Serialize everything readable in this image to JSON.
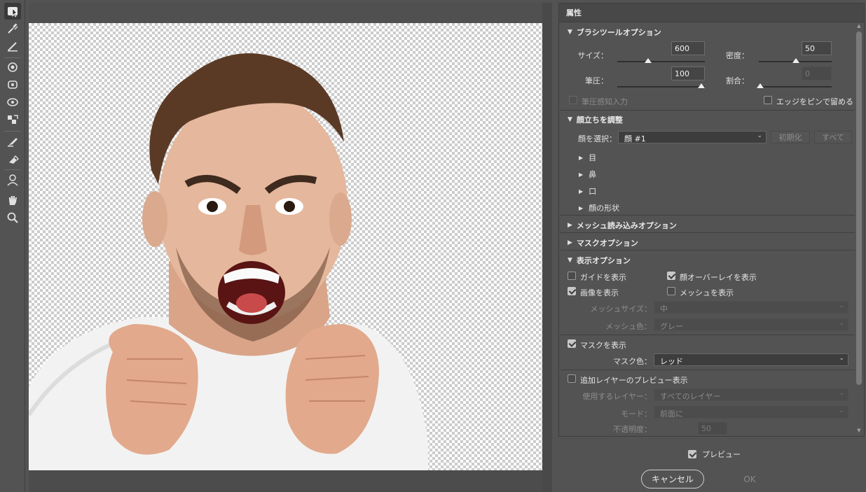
{
  "panel": {
    "title": "属性",
    "brush": {
      "title": "ブラシツールオプション",
      "size_label": "サイズ：",
      "size_value": "600",
      "density_label": "密度：",
      "density_value": "50",
      "pressure_label": "筆圧：",
      "pressure_value": "100",
      "rate_label": "割合：",
      "rate_value": "0",
      "stylus_label": "筆圧感知入力",
      "pin_edges_label": "エッジをピンで留める"
    },
    "face": {
      "title": "顔立ちを調整",
      "select_label": "顔を選択：",
      "select_value": "顔 #1",
      "reset_label": "初期化",
      "all_label": "すべて",
      "items": [
        {
          "label": "目"
        },
        {
          "label": "鼻"
        },
        {
          "label": "口"
        },
        {
          "label": "顔の形状"
        }
      ]
    },
    "mesh_load": {
      "title": "メッシュ読み込みオプション"
    },
    "mask_options": {
      "title": "マスクオプション"
    },
    "view": {
      "title": "表示オプション",
      "show_guides": "ガイドを表示",
      "show_face_overlay": "顔オーバーレイを表示",
      "show_image": "画像を表示",
      "show_mesh": "メッシュを表示",
      "mesh_size_label": "メッシュサイズ：",
      "mesh_size_value": "中",
      "mesh_color_label": "メッシュ色：",
      "mesh_color_value": "グレー",
      "show_mask": "マスクを表示",
      "mask_color_label": "マスク色：",
      "mask_color_value": "レッド",
      "show_backdrop": "追加レイヤーのプレビュー表示",
      "use_layer_label": "使用するレイヤー：",
      "use_layer_value": "すべてのレイヤー",
      "mode_label": "モード：",
      "mode_value": "前面に",
      "opacity_label": "不透明度：",
      "opacity_value": "50"
    }
  },
  "footer": {
    "preview_label": "プレビュー",
    "cancel_label": "キャンセル",
    "ok_label": "OK"
  },
  "icons": [
    "face-tool-icon",
    "forward-warp-icon",
    "reconstruct-icon",
    "smooth-icon",
    "twirl-icon",
    "pucker-icon",
    "bloat-icon",
    "push-left-icon",
    "freeze-mask-icon",
    "thaw-mask-icon",
    "face-icon",
    "hand-icon",
    "zoom-icon"
  ]
}
